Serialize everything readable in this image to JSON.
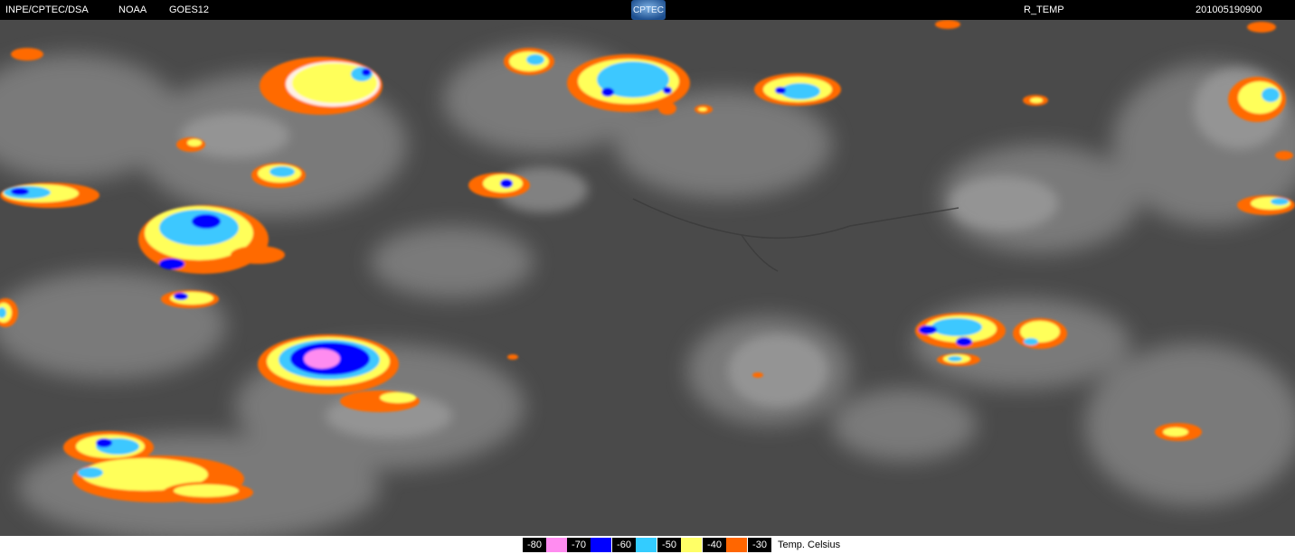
{
  "header": {
    "agency": "INPE/CPTEC/DSA",
    "provider": "NOAA",
    "satellite": "GOES12",
    "logo_text": "CPTEC",
    "product": "R_TEMP",
    "timestamp": "201005190900"
  },
  "legend": {
    "unit": "Temp. Celsius",
    "items": [
      {
        "label": "-80",
        "color": "#ff8cf0"
      },
      {
        "label": "-70",
        "color": "#0000ff"
      },
      {
        "label": "-60",
        "color": "#33ccff"
      },
      {
        "label": "-50",
        "color": "#ffff66"
      },
      {
        "label": "-40",
        "color": "#ff6600"
      },
      {
        "label": "-30",
        "color": "#ff6600"
      }
    ]
  },
  "palette": {
    "background_gray": "#4a4a4a",
    "cloud_gray": "#8c8c8c",
    "orange": "#ff6a00",
    "yellow": "#ffff5a",
    "cyan": "#3cc8ff",
    "blue": "#0000ff",
    "pink": "#ff8cf0"
  }
}
